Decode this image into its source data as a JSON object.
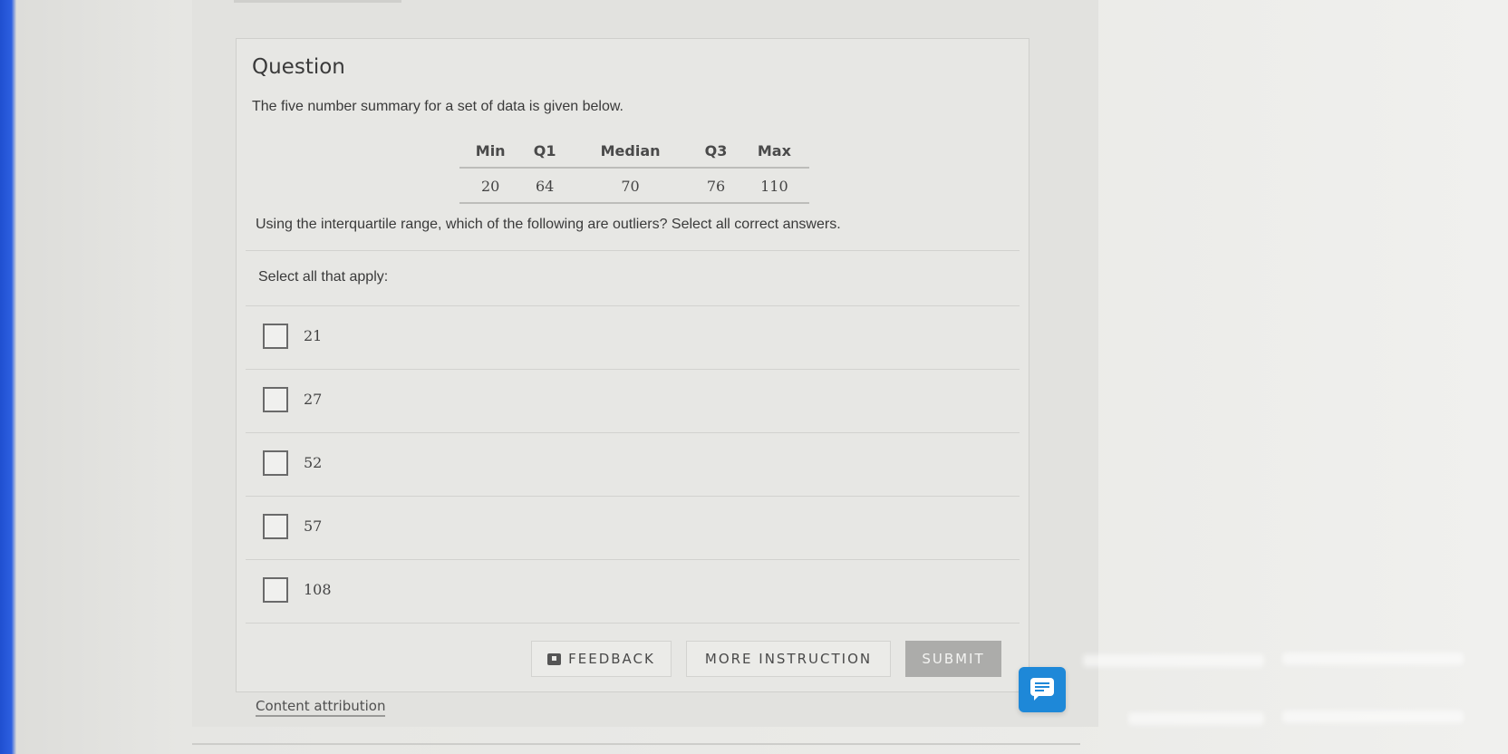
{
  "card": {
    "title": "Question",
    "prompt": "The five number summary for a set of data is given below.",
    "summary_table": {
      "headers": [
        "Min",
        "Q1",
        "Median",
        "Q3",
        "Max"
      ],
      "values": [
        "20",
        "64",
        "70",
        "76",
        "110"
      ]
    },
    "question": "Using the interquartile range, which of the following are outliers? Select all correct answers.",
    "select_label": "Select all that apply:",
    "options": [
      {
        "label": "21",
        "checked": false
      },
      {
        "label": "27",
        "checked": false
      },
      {
        "label": "52",
        "checked": false
      },
      {
        "label": "57",
        "checked": false
      },
      {
        "label": "108",
        "checked": false
      }
    ]
  },
  "actions": {
    "feedback_label": "FEEDBACK",
    "more_instruction_label": "MORE INSTRUCTION",
    "submit_label": "SUBMIT"
  },
  "footer": {
    "attribution_label": "Content attribution"
  },
  "icons": {
    "feedback": "feedback-icon",
    "chat": "chat-icon",
    "checkbox": "checkbox-icon"
  },
  "colors": {
    "chat_button": "#1e88d8",
    "submit_disabled": "#acacaa"
  }
}
